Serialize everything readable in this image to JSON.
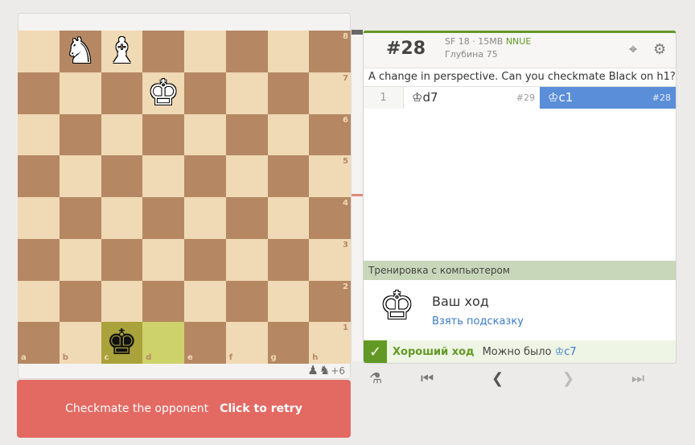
{
  "board": {
    "ranks": [
      "8",
      "7",
      "6",
      "5",
      "4",
      "3",
      "2",
      "1"
    ],
    "files": [
      "a",
      "b",
      "c",
      "d",
      "e",
      "f",
      "g",
      "h"
    ],
    "pieces": [
      {
        "square": "b8",
        "glyph": "♞",
        "color": "white"
      },
      {
        "square": "c8",
        "glyph": "♝",
        "color": "white"
      },
      {
        "square": "d7",
        "glyph": "♚",
        "color": "white"
      },
      {
        "square": "c1",
        "glyph": "♚",
        "color": "black"
      }
    ],
    "highlights": [
      "c1",
      "d1"
    ],
    "material": {
      "pieces": [
        "♟",
        "♞"
      ],
      "score": "+6"
    }
  },
  "retry": {
    "message": "Checkmate the opponent",
    "action": "Click to retry"
  },
  "ceval": {
    "percent": "#28",
    "engine": "SF 18 · 15MB",
    "nnue": "NNUE",
    "depth": "Глубина 75"
  },
  "puzzle_text": "A change in perspective. Can you checkmate Black on h1?",
  "moves": {
    "number": "1",
    "white_move": "♔d7",
    "white_tag": "#29",
    "black_move": "♔c1",
    "black_tag": "#28"
  },
  "computer": {
    "header": "Тренировка с компьютером",
    "your_turn": "Ваш ход",
    "hint": "Взять подсказку"
  },
  "feedback": {
    "good": "Хороший ход",
    "alt_label": "Можно было",
    "alt_move": "♔c7"
  },
  "icons": {
    "target": "crosshair-icon",
    "settings": "gear-icon",
    "analysis": "microscope-icon",
    "first": "first-icon",
    "prev": "prev-icon",
    "next": "next-icon",
    "last": "last-icon"
  }
}
